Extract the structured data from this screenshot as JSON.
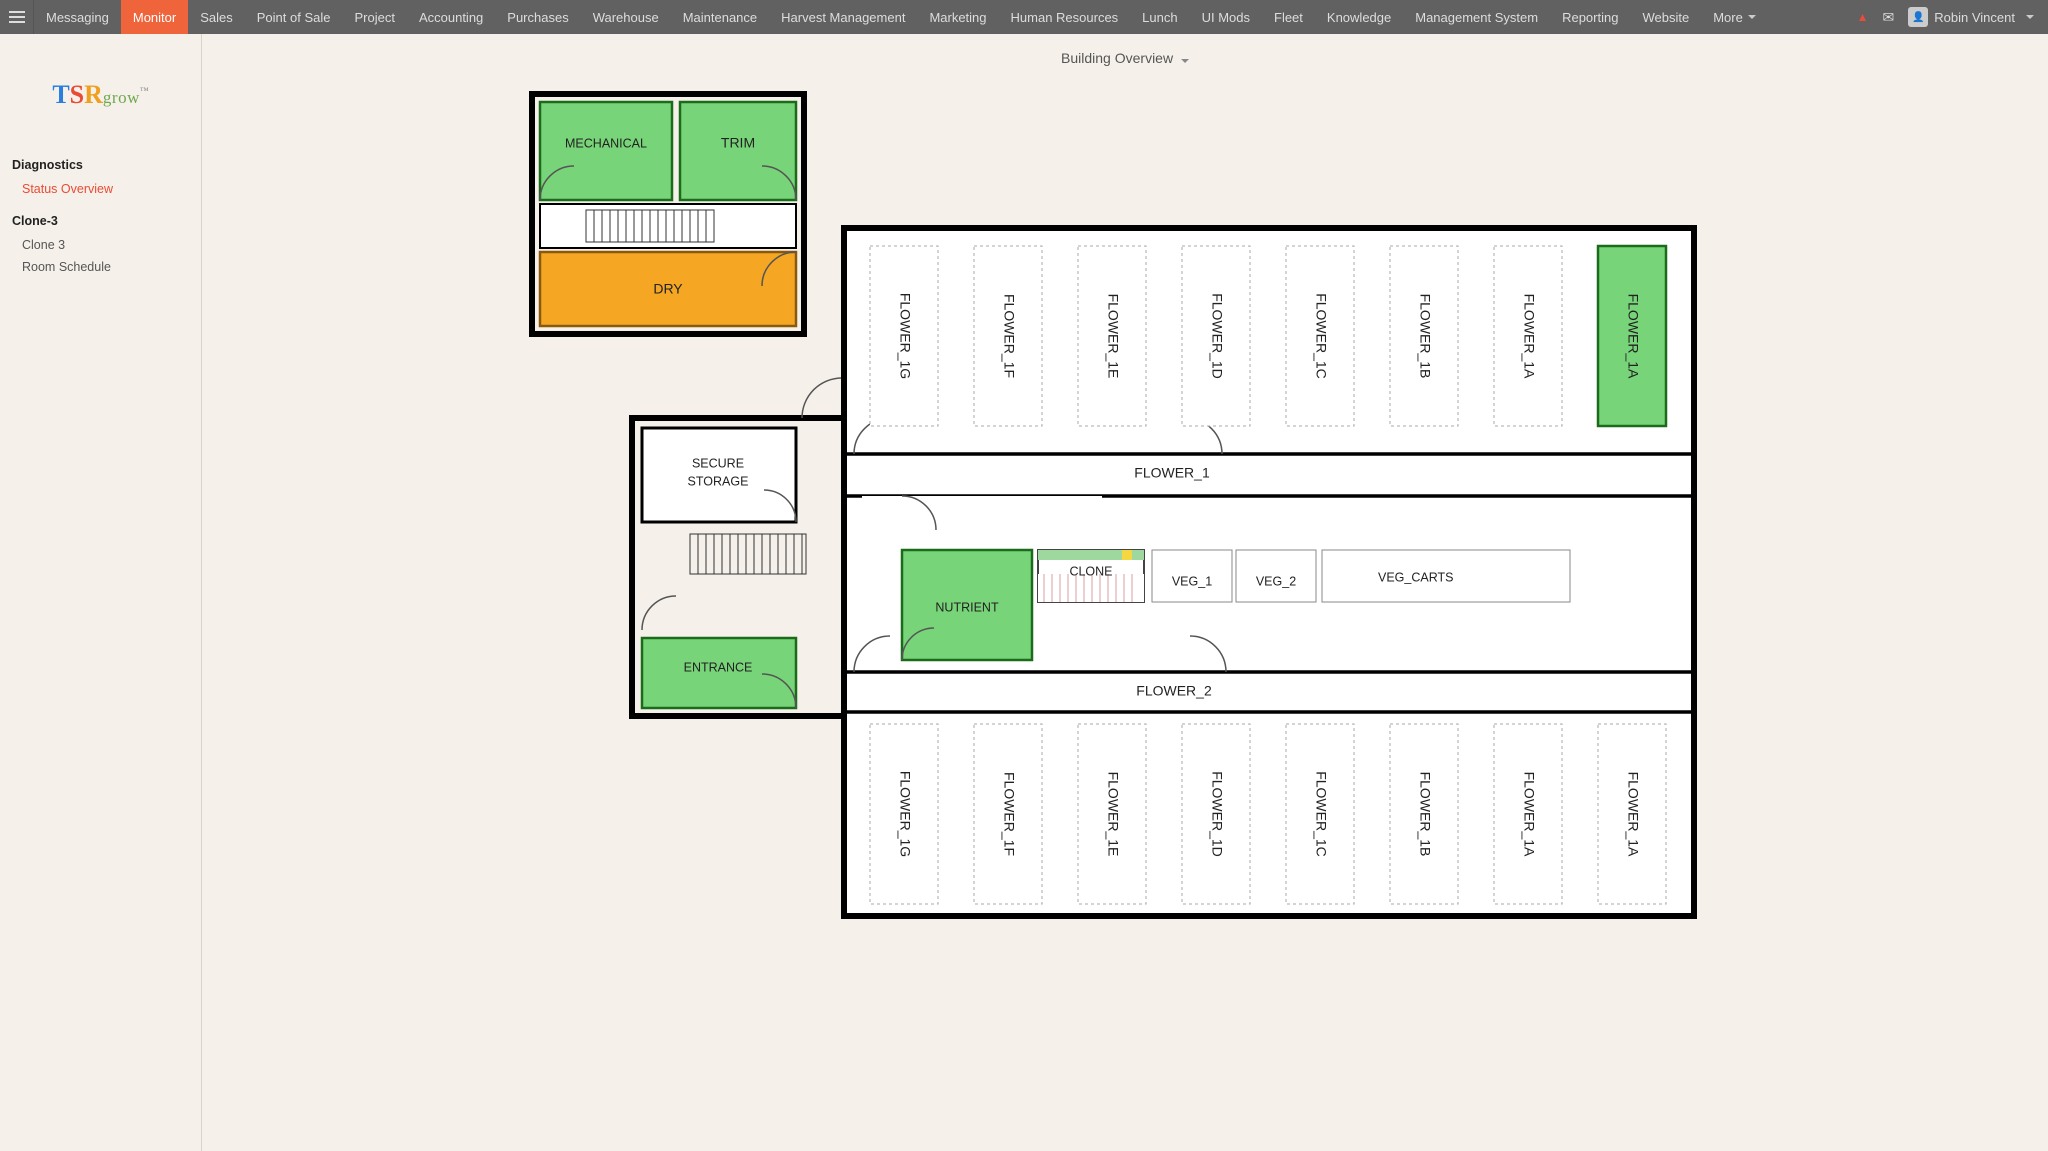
{
  "nav": {
    "items": [
      "Messaging",
      "Monitor",
      "Sales",
      "Point of Sale",
      "Project",
      "Accounting",
      "Purchases",
      "Warehouse",
      "Maintenance",
      "Harvest Management",
      "Marketing",
      "Human Resources",
      "Lunch",
      "UI Mods",
      "Fleet",
      "Knowledge",
      "Management System",
      "Reporting",
      "Website"
    ],
    "more": "More",
    "active": "Monitor",
    "user": "Robin Vincent"
  },
  "sidebar": {
    "logo_parts": {
      "t": "T",
      "s": "S",
      "r": "R",
      "grow": "grow",
      "tm": "™"
    },
    "sections": [
      {
        "title": "Diagnostics",
        "items": [
          {
            "label": "Status Overview",
            "active": true
          }
        ]
      },
      {
        "title": "Clone-3",
        "items": [
          {
            "label": "Clone 3",
            "active": false
          },
          {
            "label": "Room Schedule",
            "active": false
          }
        ]
      }
    ]
  },
  "page": {
    "title": "Building Overview"
  },
  "rooms": {
    "mechanical": "MECHANICAL",
    "trim": "TRIM",
    "dry": "DRY",
    "secure_storage_l1": "SECURE",
    "secure_storage_l2": "STORAGE",
    "entrance": "ENTRANCE",
    "nutrient": "NUTRIENT",
    "clone": "CLONE",
    "veg1": "VEG_1",
    "veg2": "VEG_2",
    "veg_carts": "VEG_CARTS",
    "flower1_corridor": "FLOWER_1",
    "flower2_corridor": "FLOWER_2",
    "flower_top": [
      "FLOWER_1G",
      "FLOWER_1F",
      "FLOWER_1E",
      "FLOWER_1D",
      "FLOWER_1C",
      "FLOWER_1B",
      "FLOWER_1A",
      "FLOWER_1A"
    ],
    "flower_bottom": [
      "FLOWER_1G",
      "FLOWER_1F",
      "FLOWER_1E",
      "FLOWER_1D",
      "FLOWER_1C",
      "FLOWER_1B",
      "FLOWER_1A",
      "FLOWER_1A"
    ]
  },
  "colors": {
    "green": "#78d478",
    "orange": "#f5a623",
    "accent": "#f0643c"
  }
}
